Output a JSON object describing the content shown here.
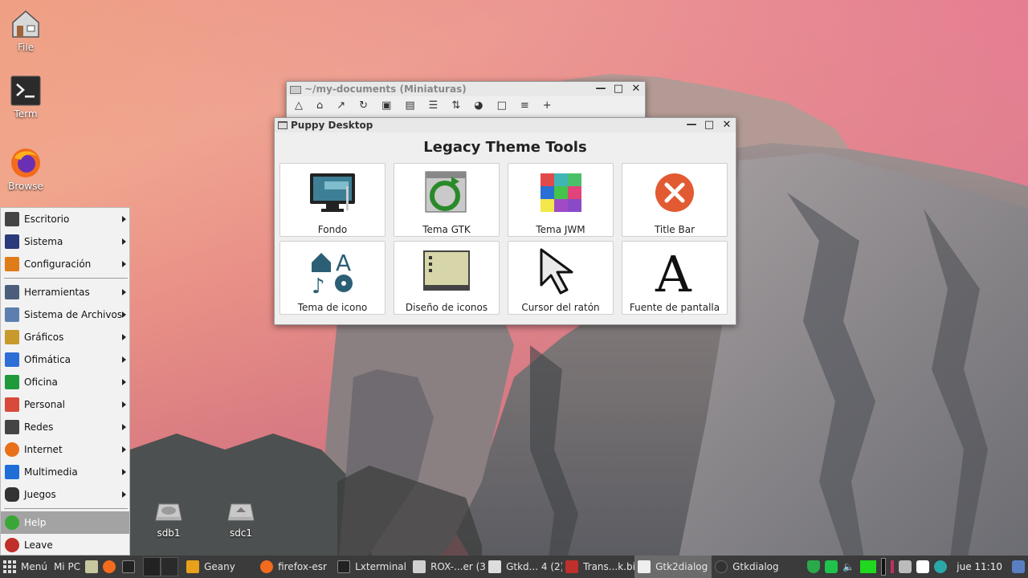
{
  "desktop": {
    "icons": [
      {
        "label": "File",
        "icon": "file-manager-icon"
      },
      {
        "label": "Term",
        "icon": "terminal-icon"
      },
      {
        "label": "Browse",
        "icon": "firefox-icon"
      }
    ],
    "drives": [
      {
        "label": "sdb1",
        "icon": "drive-icon"
      },
      {
        "label": "sdc1",
        "icon": "drive-icon"
      }
    ]
  },
  "menu": {
    "items": [
      {
        "label": "Escritorio",
        "icon": "desktop-icon",
        "color": "#444444",
        "submenu": true
      },
      {
        "label": "Sistema",
        "icon": "system-icon",
        "color": "#2a3a7a",
        "submenu": true
      },
      {
        "label": "Configuración",
        "icon": "settings-icon",
        "color": "#e07b1a",
        "submenu": true
      },
      {
        "label": "Herramientas",
        "icon": "tools-icon",
        "color": "#4b5d7a",
        "submenu": true
      },
      {
        "label": "Sistema de Archivos",
        "icon": "filesystem-icon",
        "color": "#5c7fb0",
        "submenu": true
      },
      {
        "label": "Gráficos",
        "icon": "graphics-icon",
        "color": "#c89a2c",
        "submenu": true
      },
      {
        "label": "Ofimática",
        "icon": "office-icon",
        "color": "#2d6fd6",
        "submenu": true
      },
      {
        "label": "Oficina",
        "icon": "spreadsheet-icon",
        "color": "#1f9a3a",
        "submenu": true
      },
      {
        "label": "Personal",
        "icon": "calendar-icon",
        "color": "#d84a3a",
        "submenu": true
      },
      {
        "label": "Redes",
        "icon": "network-icon",
        "color": "#444444",
        "submenu": true
      },
      {
        "label": "Internet",
        "icon": "internet-icon",
        "color": "#e8701a",
        "submenu": true
      },
      {
        "label": "Multimedia",
        "icon": "multimedia-icon",
        "color": "#1f6ed8",
        "submenu": true
      },
      {
        "label": "Juegos",
        "icon": "gamepad-icon",
        "color": "#333333",
        "submenu": true
      }
    ],
    "help": {
      "label": "Help",
      "icon": "help-icon",
      "color": "#3aa636"
    },
    "leave": {
      "label": "Leave",
      "icon": "power-icon",
      "color": "#c0302a"
    }
  },
  "rox_window": {
    "title": "~/my-documents (Miniaturas)",
    "toolbar": [
      "up-icon",
      "home-icon",
      "bookmark-icon",
      "refresh-icon",
      "zoom-icon",
      "resize-icon",
      "details-icon",
      "sort-icon",
      "hidden-icon",
      "select-icon",
      "list-icon",
      "add-icon"
    ]
  },
  "puppy_window": {
    "title": "Puppy Desktop",
    "heading": "Legacy Theme Tools",
    "tools": [
      {
        "label": "Fondo",
        "icon": "wallpaper-monitor-icon"
      },
      {
        "label": "Tema GTK",
        "icon": "gtk-theme-icon"
      },
      {
        "label": "Tema JWM",
        "icon": "jwm-theme-icon"
      },
      {
        "label": "Title Bar",
        "icon": "titlebar-close-icon"
      },
      {
        "label": "Tema de icono",
        "icon": "icon-theme-icon"
      },
      {
        "label": "Diseño de iconos",
        "icon": "icon-layout-icon"
      },
      {
        "label": "Cursor del ratón",
        "icon": "mouse-cursor-icon"
      },
      {
        "label": "Fuente de pantalla",
        "icon": "font-icon"
      }
    ]
  },
  "taskbar": {
    "menu_label": "Menú",
    "mypc_label": "Mi PC",
    "tasks": [
      {
        "label": "Geany",
        "icon": "geany-icon"
      },
      {
        "label": "firefox-esr",
        "icon": "firefox-icon"
      },
      {
        "label": "Lxterminal",
        "icon": "terminal-icon"
      },
      {
        "label": "ROX-...er (3)",
        "icon": "rox-icon"
      },
      {
        "label": "Gtkd... 4 (2)",
        "icon": "window-icon"
      },
      {
        "label": "Trans...k.bin",
        "icon": "transmission-icon"
      },
      {
        "label": "Gtk2dialog",
        "icon": "window-icon",
        "active": true
      },
      {
        "label": "Gtkdialog",
        "icon": "window-icon"
      }
    ],
    "clock": "jue 11:10"
  }
}
